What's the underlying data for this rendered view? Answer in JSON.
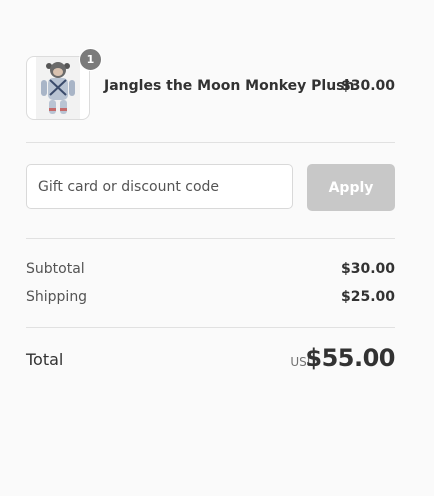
{
  "product": {
    "name": "Jangles the Moon Monkey Plush",
    "price": "$30.00",
    "quantity": "1",
    "thumbnail_icon": "monkey-plush-image"
  },
  "discount": {
    "placeholder": "Gift card or discount code",
    "value": "",
    "apply_label": "Apply"
  },
  "summary": {
    "subtotal_label": "Subtotal",
    "subtotal_value": "$30.00",
    "shipping_label": "Shipping",
    "shipping_value": "$25.00",
    "total_label": "Total",
    "currency": "USD",
    "total_value": "$55.00"
  },
  "colors": {
    "background": "#fafafa",
    "badge": "#7b7b7b",
    "button_disabled": "#c8c8c8",
    "text": "#323232",
    "muted_text": "#545454"
  }
}
